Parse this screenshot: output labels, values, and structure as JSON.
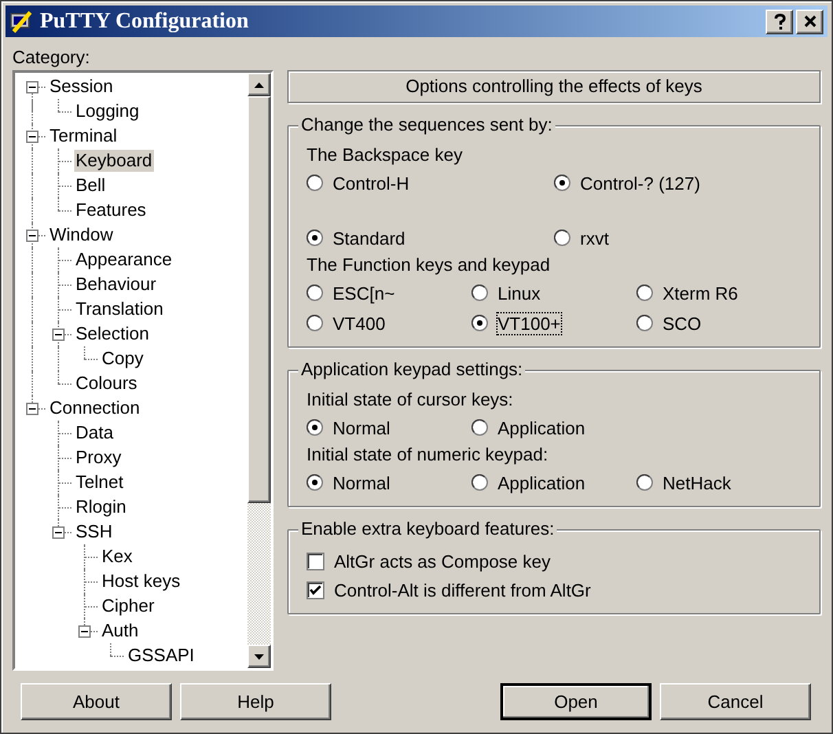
{
  "window": {
    "title": "PuTTY Configuration"
  },
  "category_label": "Category:",
  "tree": [
    {
      "label": "Session",
      "selected": false,
      "expanded": true,
      "children": [
        {
          "label": "Logging",
          "selected": false
        }
      ]
    },
    {
      "label": "Terminal",
      "selected": false,
      "expanded": true,
      "children": [
        {
          "label": "Keyboard",
          "selected": true
        },
        {
          "label": "Bell",
          "selected": false
        },
        {
          "label": "Features",
          "selected": false
        }
      ]
    },
    {
      "label": "Window",
      "selected": false,
      "expanded": true,
      "children": [
        {
          "label": "Appearance",
          "selected": false
        },
        {
          "label": "Behaviour",
          "selected": false
        },
        {
          "label": "Translation",
          "selected": false
        },
        {
          "label": "Selection",
          "selected": false,
          "expanded": true,
          "children": [
            {
              "label": "Copy",
              "selected": false
            }
          ]
        },
        {
          "label": "Colours",
          "selected": false
        }
      ]
    },
    {
      "label": "Connection",
      "selected": false,
      "expanded": true,
      "children": [
        {
          "label": "Data",
          "selected": false
        },
        {
          "label": "Proxy",
          "selected": false
        },
        {
          "label": "Telnet",
          "selected": false
        },
        {
          "label": "Rlogin",
          "selected": false
        },
        {
          "label": "SSH",
          "selected": false,
          "expanded": true,
          "children": [
            {
              "label": "Kex",
              "selected": false
            },
            {
              "label": "Host keys",
              "selected": false
            },
            {
              "label": "Cipher",
              "selected": false
            },
            {
              "label": "Auth",
              "selected": false,
              "expanded": true,
              "children": [
                {
                  "label": "GSSAPI",
                  "selected": false
                }
              ]
            }
          ]
        }
      ]
    }
  ],
  "panel_header": "Options controlling the effects of keys",
  "groups": [
    {
      "title": "Change the sequences sent by:",
      "sections": [
        {
          "label": "The Backspace key",
          "kind": "pair",
          "options": [
            {
              "label": "Control-H",
              "selected": false,
              "focused": false
            },
            {
              "label": "Control-? (127)",
              "selected": true,
              "focused": false
            }
          ]
        },
        {
          "kind": "pair",
          "options": [
            {
              "label": "Standard",
              "selected": true,
              "focused": false
            },
            {
              "label": "rxvt",
              "selected": false,
              "focused": false
            }
          ]
        },
        {
          "label": "The Function keys and keypad",
          "kind": "triple",
          "options": [
            {
              "label": "ESC[n~",
              "selected": false,
              "focused": false
            },
            {
              "label": "Linux",
              "selected": false,
              "focused": false
            },
            {
              "label": "Xterm R6",
              "selected": false,
              "focused": false
            },
            {
              "label": "VT400",
              "selected": false,
              "focused": false
            },
            {
              "label": "VT100+",
              "selected": true,
              "focused": true
            },
            {
              "label": "SCO",
              "selected": false,
              "focused": false
            }
          ]
        }
      ]
    },
    {
      "title": "Application keypad settings:",
      "sections": [
        {
          "label": "Initial state of cursor keys:",
          "kind": "triple",
          "options": [
            {
              "label": "Normal",
              "selected": true,
              "focused": false
            },
            {
              "label": "Application",
              "selected": false,
              "focused": false
            }
          ]
        },
        {
          "label": "Initial state of numeric keypad:",
          "kind": "triple",
          "options": [
            {
              "label": "Normal",
              "selected": true,
              "focused": false
            },
            {
              "label": "Application",
              "selected": false,
              "focused": false
            },
            {
              "label": "NetHack",
              "selected": false,
              "focused": false
            }
          ]
        }
      ]
    },
    {
      "title": "Enable extra keyboard features:",
      "checkboxes": [
        {
          "label": "AltGr acts as Compose key",
          "checked": false
        },
        {
          "label": "Control-Alt is different from AltGr",
          "checked": true
        }
      ]
    }
  ],
  "buttons": [
    {
      "label": "About",
      "default": false
    },
    {
      "label": "Help",
      "default": false
    },
    {
      "label": "Open",
      "default": true
    },
    {
      "label": "Cancel",
      "default": false
    }
  ]
}
